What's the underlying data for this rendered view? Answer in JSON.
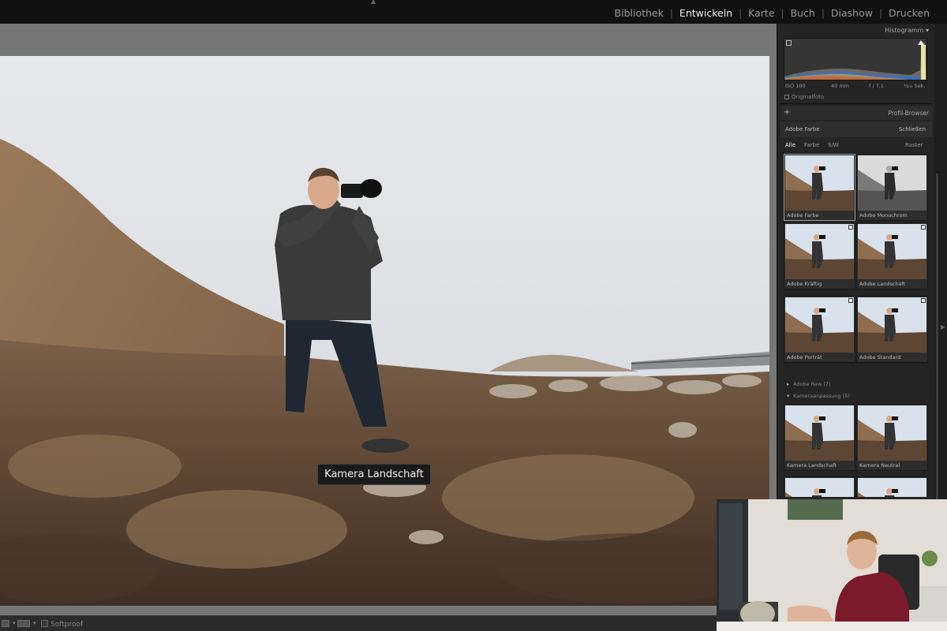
{
  "modules": {
    "items": [
      "Bibliothek",
      "Entwickeln",
      "Karte",
      "Buch",
      "Diashow",
      "Drucken"
    ],
    "active": "Entwickeln"
  },
  "histogram": {
    "title": "Histogramm",
    "iso": "ISO 100",
    "focal": "40 mm",
    "aperture": "f / 7,1",
    "shutter": "¹⁄₂₀₀ Sek.",
    "original_label": "Originalfoto"
  },
  "profile_browser": {
    "title": "Profil-Browser",
    "current_profile": "Adobe Farbe",
    "close_label": "Schließen",
    "filters": [
      "Alle",
      "Farbe",
      "S/W"
    ],
    "active_filter": "Alle",
    "grid_label": "Raster",
    "thumbnails": [
      "Adobe Farbe",
      "Adobe Monochrom",
      "Adobe Kräftig",
      "Adobe Landschaft",
      "Adobe Porträt",
      "Adobe Standard"
    ],
    "groups": [
      {
        "label": "Adobe Raw (7)",
        "expanded": false
      },
      {
        "label": "Kameraanpassung (5)",
        "expanded": true
      }
    ],
    "camera_thumbnails": [
      "Kamera Landschaft",
      "Kamera Neutral"
    ]
  },
  "tooltip": {
    "text": "Kamera Landschaft"
  },
  "toolbar": {
    "softproof_label": "Softproof"
  },
  "colors": {
    "panel_bg": "#242424",
    "topbar_bg": "#111111",
    "viewer_bg": "#777777",
    "active_module": "#f0f0f0"
  }
}
